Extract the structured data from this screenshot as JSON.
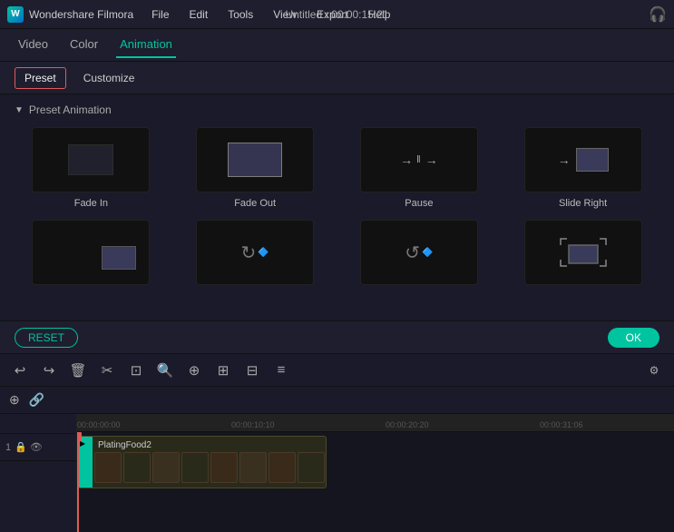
{
  "app": {
    "logo": "W",
    "name": "Wondershare Filmora",
    "title": "Untitled : 00:00:15:21"
  },
  "menubar": {
    "items": [
      "File",
      "Edit",
      "Tools",
      "View",
      "Export",
      "Help"
    ]
  },
  "tabs": {
    "items": [
      "Video",
      "Color",
      "Animation"
    ],
    "active": "Animation"
  },
  "subtabs": {
    "items": [
      "Preset",
      "Customize"
    ],
    "active": "Preset"
  },
  "section": {
    "label": "Preset Animation"
  },
  "animations": {
    "row1": [
      {
        "id": "fade-in",
        "label": "Fade In",
        "type": "fade-in"
      },
      {
        "id": "fade-out",
        "label": "Fade Out",
        "type": "fade-out"
      },
      {
        "id": "pause",
        "label": "Pause",
        "type": "pause"
      },
      {
        "id": "slide-right",
        "label": "Slide Right",
        "type": "slide-right"
      }
    ],
    "row2": [
      {
        "id": "anim-5",
        "label": "",
        "type": "bottom-right"
      },
      {
        "id": "anim-6",
        "label": "",
        "type": "rotate-cw"
      },
      {
        "id": "anim-7",
        "label": "",
        "type": "rotate-ccw"
      },
      {
        "id": "anim-8",
        "label": "",
        "type": "expand"
      }
    ]
  },
  "buttons": {
    "reset": "RESET",
    "ok": "OK"
  },
  "toolbar": {
    "icons": [
      "↩",
      "↪",
      "🗑",
      "✂",
      "⊞",
      "🔍",
      "⊕",
      "⊡",
      "⊟",
      "≡"
    ],
    "settings": "⚙"
  },
  "timeline": {
    "icons": [
      "⊕",
      "🔗"
    ],
    "timestamps": [
      "00:00:00:00",
      "00:00:10:10",
      "00:00:20:20",
      "00:00:31:06"
    ],
    "clip_name": "PlatingFood2",
    "track_label": "1"
  }
}
